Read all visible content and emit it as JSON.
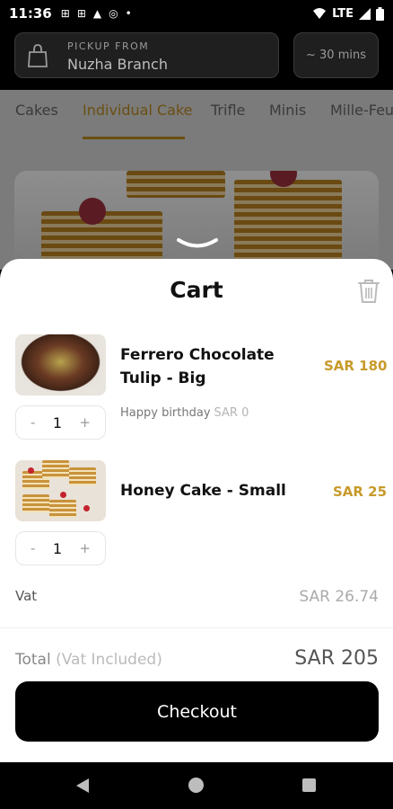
{
  "status_bar": {
    "time": "11:36",
    "notification_icons": [
      "notification-icon",
      "notification-icon",
      "drive-icon",
      "sync-icon",
      "dot-icon"
    ],
    "network": "LTE",
    "icons": [
      "wifi-icon",
      "signal-icon",
      "battery-icon"
    ]
  },
  "header": {
    "pickup_label": "PICKUP FROM",
    "branch": "Nuzha Branch",
    "eta": "~ 30 mins"
  },
  "tabs": [
    {
      "label": "Cakes",
      "active": false
    },
    {
      "label": "Individual Cake",
      "active": true
    },
    {
      "label": "Trifle",
      "active": false
    },
    {
      "label": "Minis",
      "active": false
    },
    {
      "label": "Mille-Feuil",
      "active": false
    }
  ],
  "cart": {
    "title": "Cart",
    "items": [
      {
        "name_line1": "Ferrero Chocolate",
        "name_line2": "Tulip - Big",
        "price": "SAR 180",
        "note": "Happy birthday",
        "note_price": "SAR 0",
        "quantity": "1",
        "minus": "-",
        "plus": "+"
      },
      {
        "name_line1": "Honey Cake - Small",
        "price": "SAR 25",
        "quantity": "1",
        "minus": "-",
        "plus": "+"
      }
    ],
    "vat_label": "Vat",
    "vat_value": "SAR 26.74",
    "total_label": "Total",
    "total_sub": "(Vat Included)",
    "total_value": "SAR 205",
    "checkout_label": "Checkout"
  },
  "colors": {
    "accent_gold": "#c79a2a",
    "checkout_bg": "#000000"
  }
}
